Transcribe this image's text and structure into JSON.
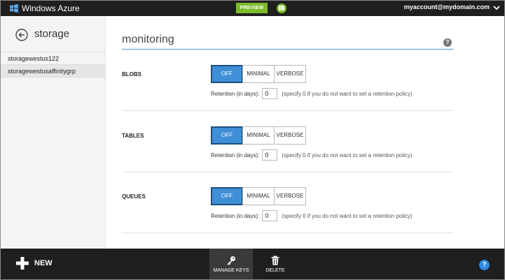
{
  "topbar": {
    "brand": "Windows Azure",
    "preview_label": "PREVIEW",
    "feedback_icon": "smiley-icon",
    "account": "myaccount@mydomain.com"
  },
  "leftpanel": {
    "title": "storage",
    "items": [
      {
        "label": "storagewestus122",
        "selected": false
      },
      {
        "label": "storagewestusaffinitygrp",
        "selected": true
      }
    ]
  },
  "main": {
    "title": "monitoring",
    "sections": [
      {
        "label": "BLOBS",
        "options": [
          "OFF",
          "MINIMAL",
          "VERBOSE"
        ],
        "selected": "OFF",
        "retention_label": "Retention (in days):",
        "retention_value": "0",
        "retention_note": "(specify 0 if you do not want to set a retention policy)"
      },
      {
        "label": "TABLES",
        "options": [
          "OFF",
          "MINIMAL",
          "VERBOSE"
        ],
        "selected": "OFF",
        "retention_label": "Retention (in days):",
        "retention_value": "0",
        "retention_note": "(specify 0 if you do not want to set a retention policy)"
      },
      {
        "label": "QUEUES",
        "options": [
          "OFF",
          "MINIMAL",
          "VERBOSE"
        ],
        "selected": "OFF",
        "retention_label": "Retention (in days):",
        "retention_value": "0",
        "retention_note": "(specify 0 if you do not want to set a retention policy)"
      }
    ]
  },
  "bottombar": {
    "new_label": "NEW",
    "manage_keys_label": "MANAGE KEYS",
    "delete_label": "DELETE"
  },
  "colors": {
    "accent": "#3f8fd6",
    "preview_green": "#7cbb2c",
    "bar_dark": "#1f1f1f"
  }
}
